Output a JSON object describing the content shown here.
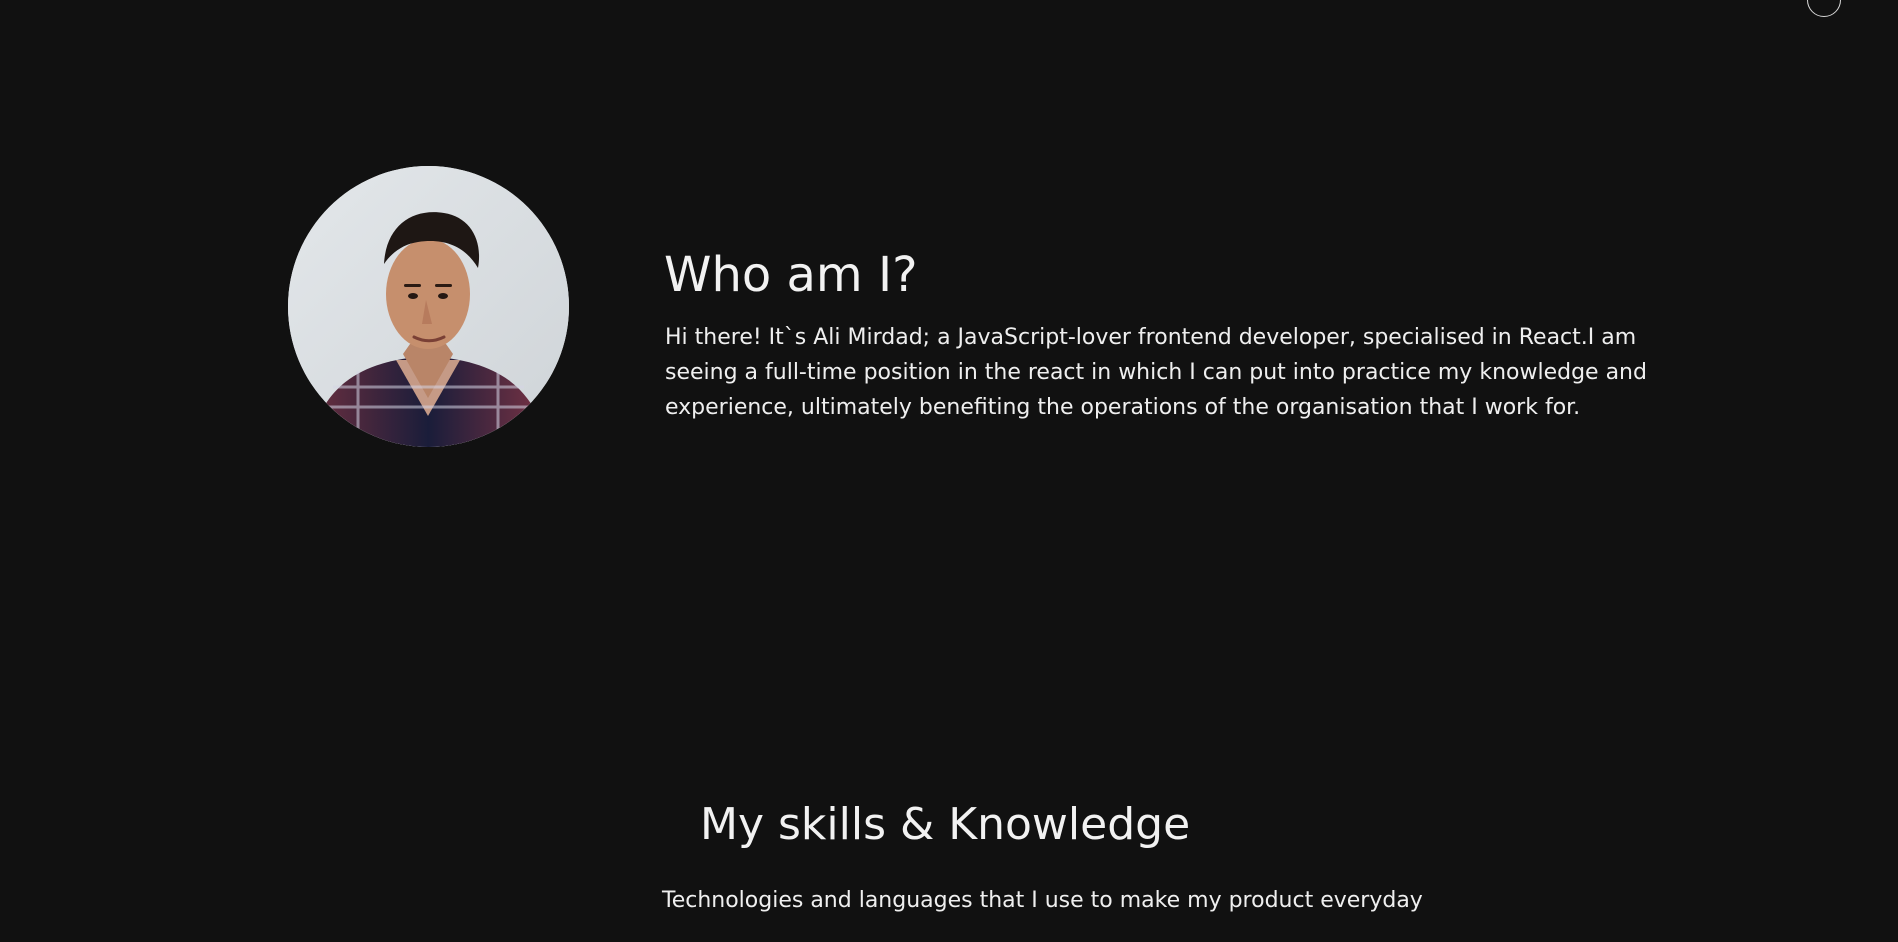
{
  "about": {
    "heading": "Who am I?",
    "text": "Hi there! It`s Ali Mirdad; a JavaScript-lover frontend developer, specialised in React.I am seeing a full-time position in the react in which I can put into practice my knowledge and experience, ultimately benefiting the operations of the organisation that I work for."
  },
  "skills": {
    "heading": "My skills & Knowledge",
    "subtitle": "Technologies and languages that I use to make my product everyday"
  },
  "colors": {
    "background": "#111111",
    "text": "#f2f2f2"
  },
  "icons": {
    "top_right": "circle-icon"
  }
}
